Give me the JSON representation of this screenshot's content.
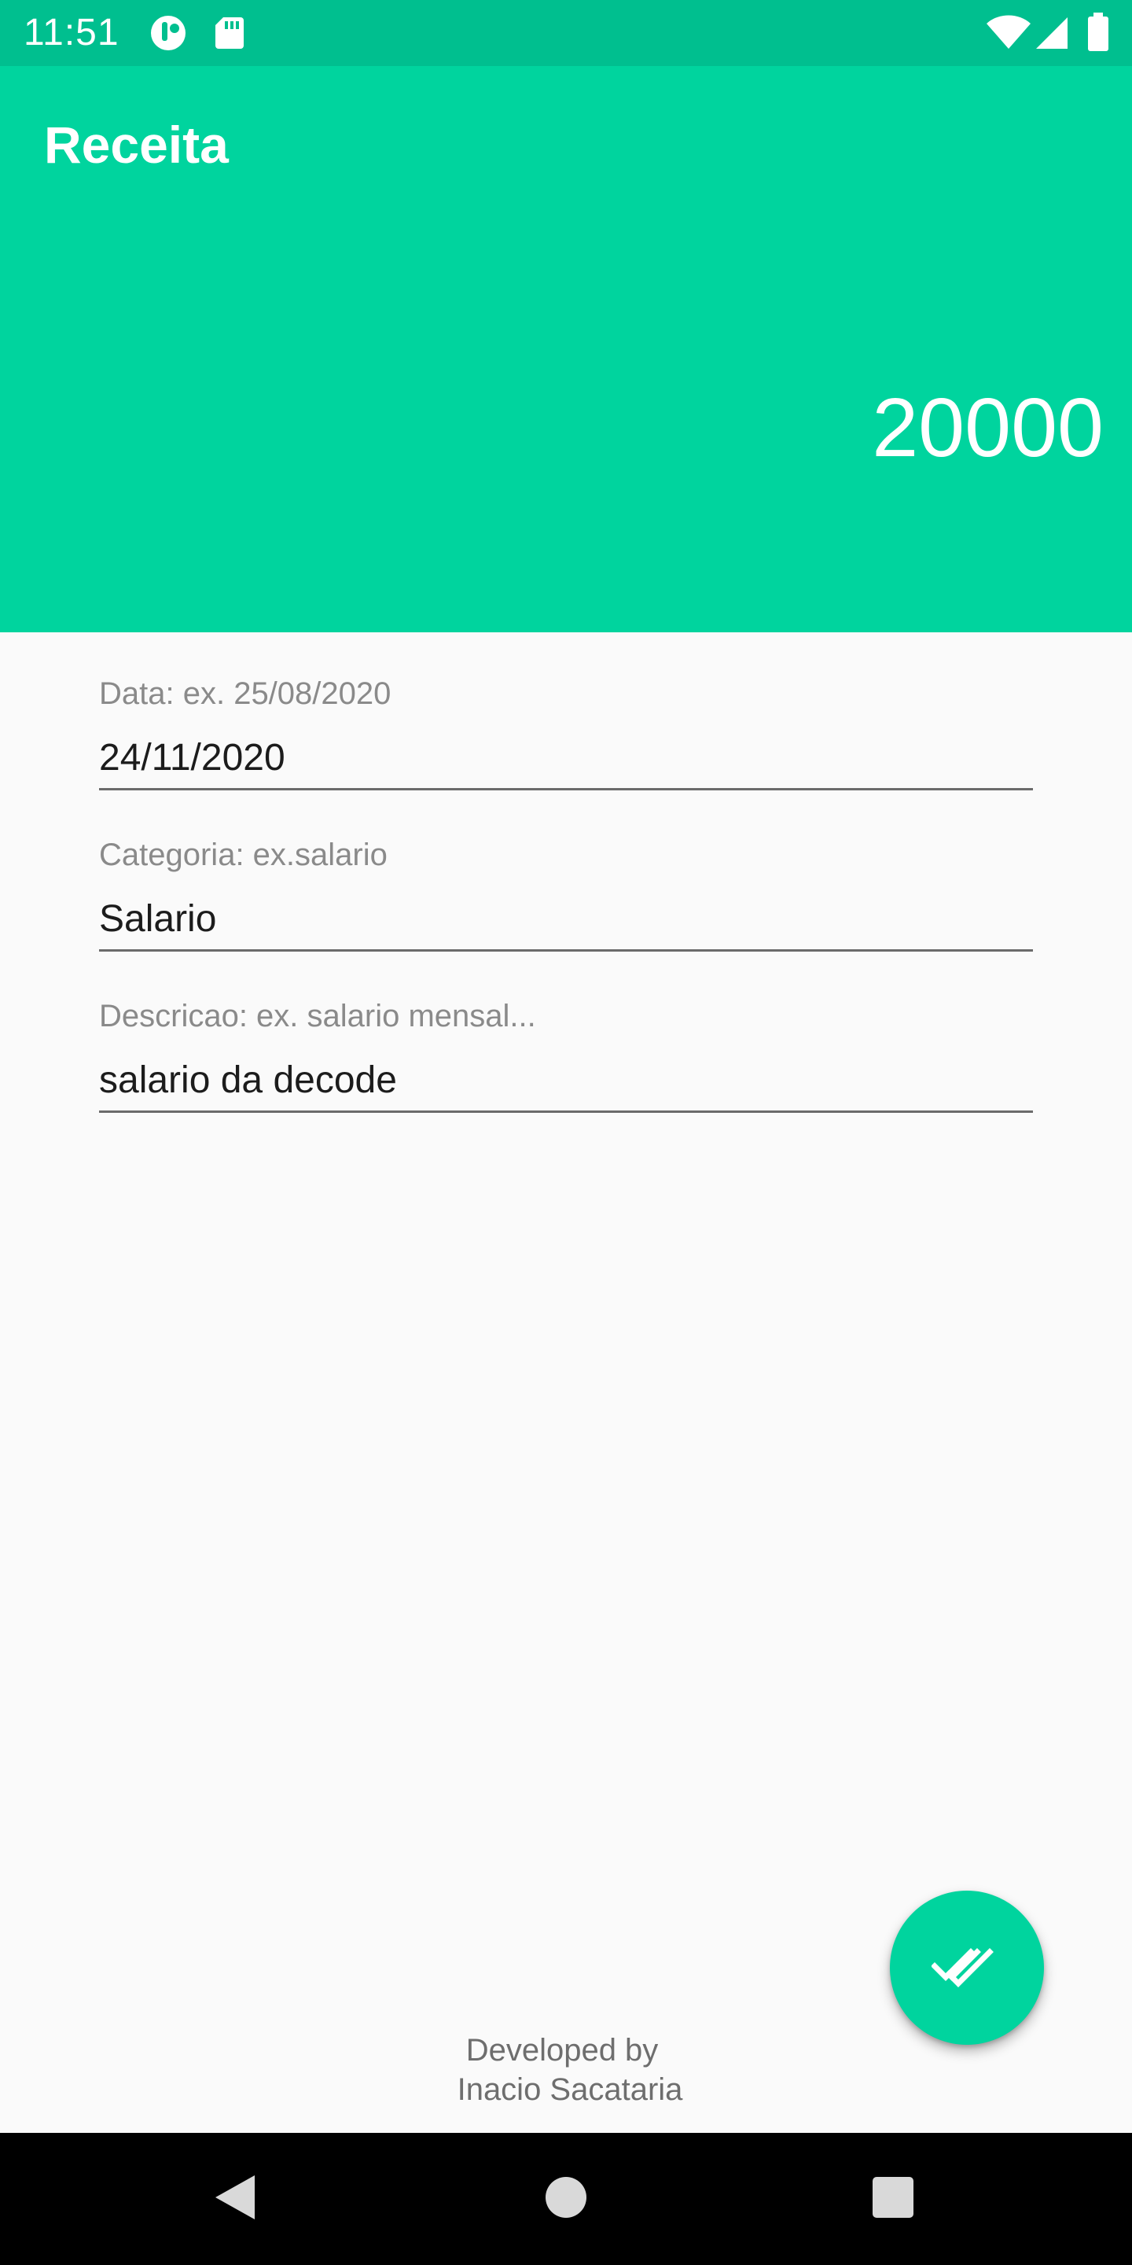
{
  "status_bar": {
    "time": "11:51",
    "icons_left": [
      "app-notification-icon",
      "sd-card-icon"
    ],
    "icons_right": [
      "wifi-icon",
      "cell-signal-icon",
      "battery-icon"
    ]
  },
  "header": {
    "title": "Receita",
    "amount": "20000"
  },
  "form": {
    "date": {
      "label": "Data: ex. 25/08/2020",
      "value": "24/11/2020"
    },
    "category": {
      "label": "Categoria: ex.salario",
      "value": "Salario"
    },
    "description": {
      "label": "Descricao: ex. salario mensal...",
      "value": "salario da decode"
    }
  },
  "fab": {
    "icon": "double-check-icon"
  },
  "credits": {
    "line1": "Developed by",
    "line2": "Inacio Sacataria"
  },
  "nav_bar": {
    "buttons": [
      "back-icon",
      "home-icon",
      "recents-icon"
    ]
  },
  "colors": {
    "status_bar": "#00bf8f",
    "header": "#00d49e",
    "accent": "#00d49e",
    "background": "#fafafa"
  }
}
